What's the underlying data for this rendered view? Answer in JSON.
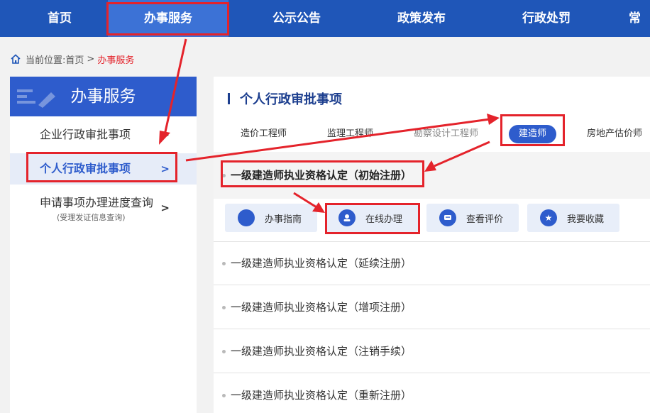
{
  "nav": {
    "items": [
      "首页",
      "办事服务",
      "公示公告",
      "政策发布",
      "行政处罚",
      "常"
    ],
    "active_index": 1
  },
  "breadcrumb": {
    "prefix": "当前位置:",
    "home": "首页",
    "separator": ">",
    "current": "办事服务"
  },
  "sidebar": {
    "title": "办事服务",
    "items": [
      {
        "label": "企业行政审批事项",
        "chevron": ">"
      },
      {
        "label": "个人行政审批事项",
        "chevron": ">"
      },
      {
        "label": "申请事项办理进度查询",
        "sublabel": "(受理发证信息查询)",
        "chevron": ">"
      }
    ]
  },
  "main": {
    "title": "个人行政审批事项",
    "tabs": [
      "造价工程师",
      "监理工程师",
      "勘察设计工程师",
      "建造师",
      "房地产估价师"
    ],
    "active_tab": 3,
    "items": [
      "一级建造师执业资格认定（初始注册）",
      "一级建造师执业资格认定（延续注册）",
      "一级建造师执业资格认定（增项注册）",
      "一级建造师执业资格认定（注销手续）",
      "一级建造师执业资格认定（重新注册）"
    ],
    "actions": [
      {
        "label": "办事指南",
        "icon": "compass-icon"
      },
      {
        "label": "在线办理",
        "icon": "person-icon"
      },
      {
        "label": "查看评价",
        "icon": "comment-icon"
      },
      {
        "label": "我要收藏",
        "icon": "star-icon"
      }
    ]
  },
  "colors": {
    "nav_bg": "#1f56b8",
    "nav_active": "#3c72d6",
    "accent": "#2e5ccc",
    "annotation_red": "#e4232b"
  }
}
